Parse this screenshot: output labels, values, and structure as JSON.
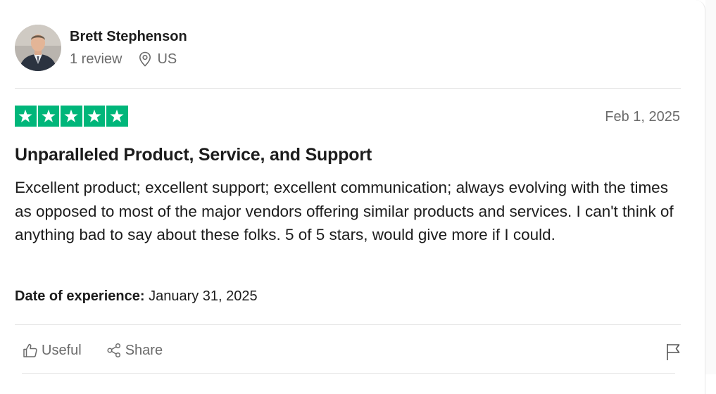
{
  "reviewer": {
    "name": "Brett Stephenson",
    "review_count": "1 review",
    "country": "US"
  },
  "review": {
    "rating": 5,
    "rating_max": 5,
    "star_color": "#00b67a",
    "date": "Feb 1, 2025",
    "title": "Unparalleled Product, Service, and Support",
    "body": "Excellent product; excellent support; excellent communication; always evolving with the times as opposed to most of the major vendors offering similar products and services. I can't think of anything bad to say about these folks. 5 of 5 stars, would give more if I could.",
    "experience_label": "Date of experience:",
    "experience_date": "January 31, 2025"
  },
  "actions": {
    "useful_label": "Useful",
    "share_label": "Share",
    "useful_icon": "thumbs-up-icon",
    "share_icon": "share-icon",
    "report_icon": "flag-icon"
  }
}
